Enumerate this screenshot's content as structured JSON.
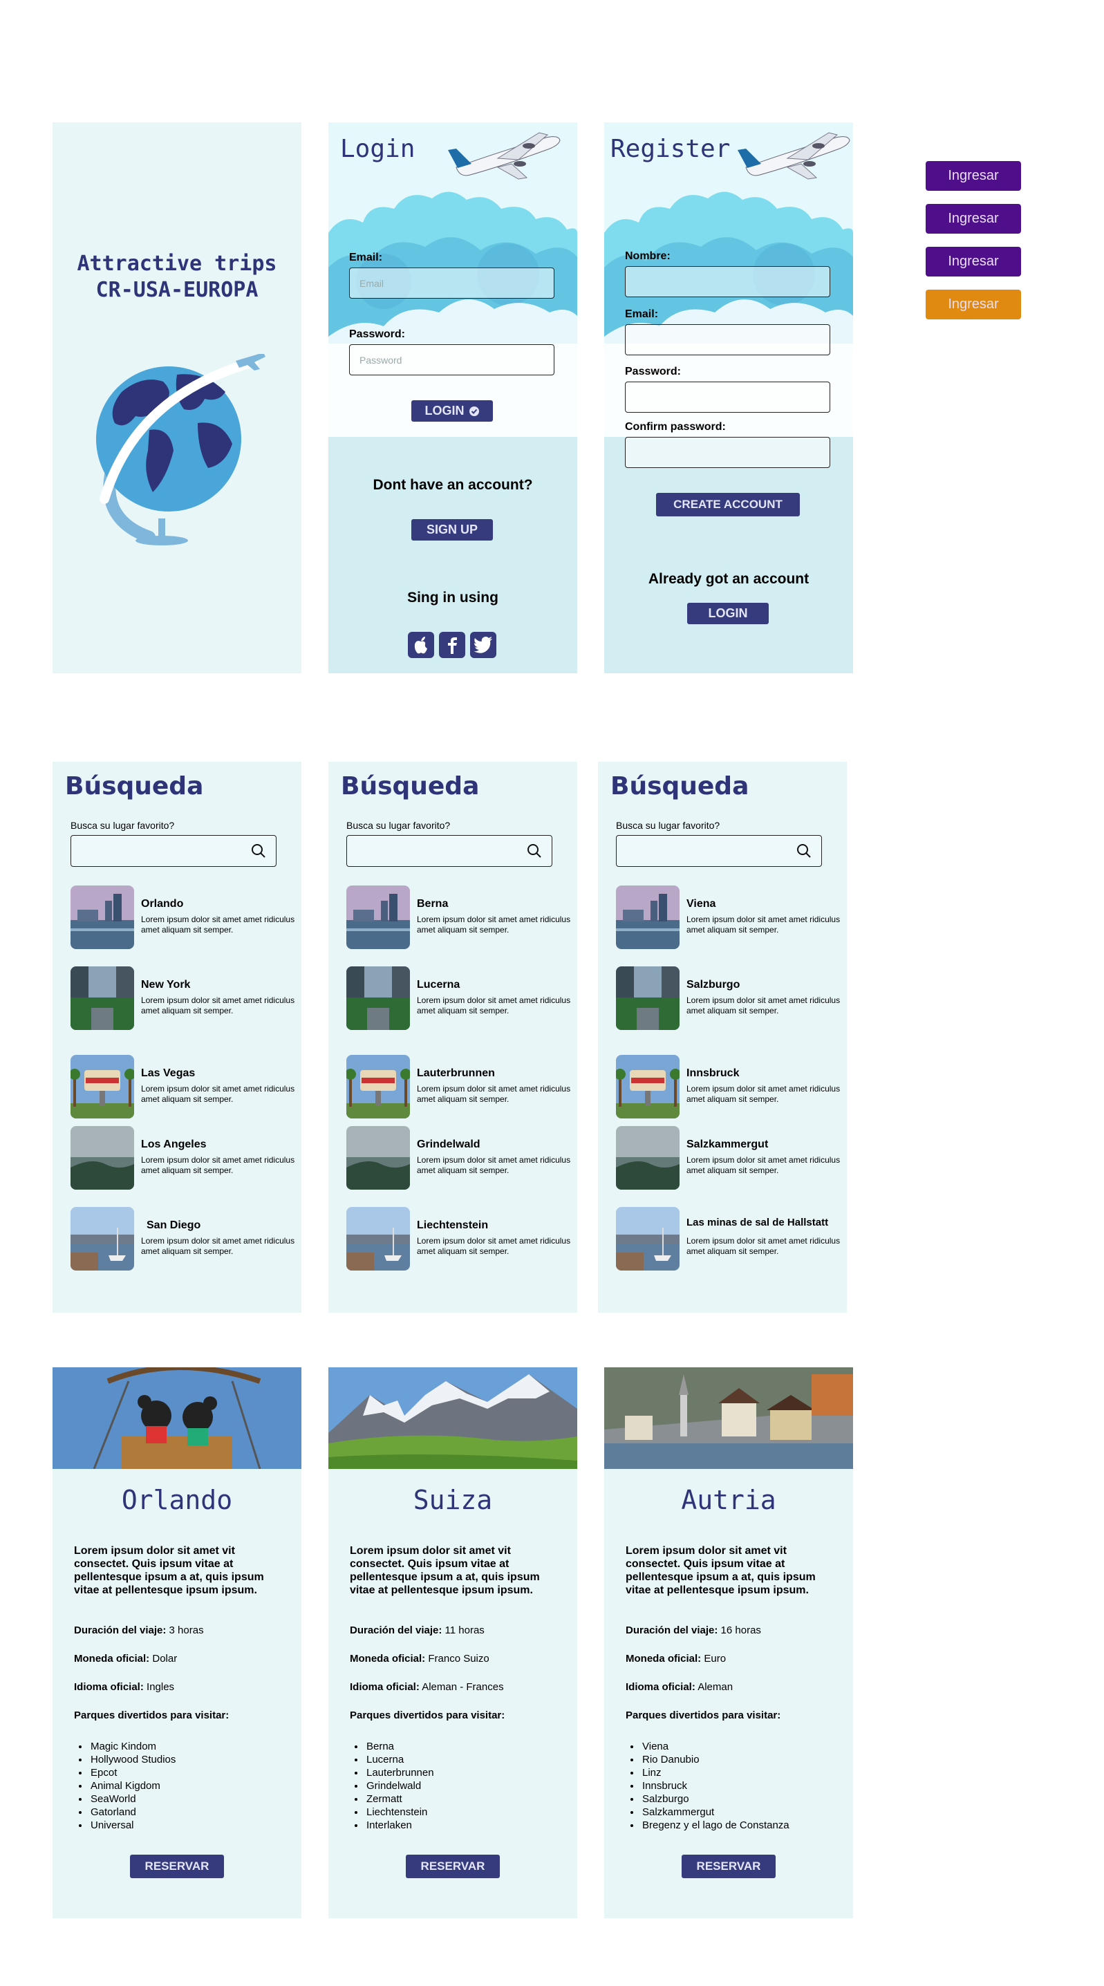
{
  "splash": {
    "title_line1": "Attractive trips",
    "title_line2": "CR-USA-EUROPA"
  },
  "login": {
    "title": "Login",
    "email_label": "Email:",
    "email_placeholder": "Email",
    "password_label": "Password:",
    "password_placeholder": "Password",
    "login_button": "LOGIN",
    "no_account_text": "Dont have an account?",
    "signup_button": "SIGN UP",
    "sign_in_using": "Sing in using"
  },
  "register": {
    "title": "Register",
    "nombre_label": "Nombre:",
    "email_label": "Email:",
    "password_label": "Password:",
    "confirm_label": "Confirm password:",
    "create_button": "CREATE ACCOUNT",
    "already_text": "Already got an account",
    "login_button": "LOGIN"
  },
  "side_buttons": [
    {
      "label": "Ingresar",
      "color": "#4f0f8a"
    },
    {
      "label": "Ingresar",
      "color": "#4f0f8a"
    },
    {
      "label": "Ingresar",
      "color": "#4f0f8a"
    },
    {
      "label": "Ingresar",
      "color": "#e08a12"
    }
  ],
  "search_common": {
    "title": "Búsqueda",
    "label": "Busca su lugar favorito?"
  },
  "search_usa": {
    "items": [
      {
        "name": "Orlando",
        "desc": "Lorem ipsum dolor sit amet amet ridiculus amet aliquam sit semper."
      },
      {
        "name": "New York",
        "desc": "Lorem ipsum dolor sit amet amet ridiculus amet aliquam sit semper."
      },
      {
        "name": "Las Vegas",
        "desc": "Lorem ipsum dolor sit amet amet ridiculus amet aliquam sit semper."
      },
      {
        "name": "Los Angeles",
        "desc": "Lorem ipsum dolor sit amet amet ridiculus amet aliquam sit semper."
      },
      {
        "name": "San Diego",
        "desc": "Lorem ipsum dolor sit amet amet ridiculus amet aliquam sit semper."
      }
    ]
  },
  "search_suiza": {
    "items": [
      {
        "name": "Berna",
        "desc": "Lorem ipsum dolor sit amet amet ridiculus amet aliquam sit semper."
      },
      {
        "name": "Lucerna",
        "desc": "Lorem ipsum dolor sit amet amet ridiculus amet aliquam sit semper."
      },
      {
        "name": "Lauterbrunnen",
        "desc": "Lorem ipsum dolor sit amet amet ridiculus amet aliquam sit semper."
      },
      {
        "name": "Grindelwald",
        "desc": "Lorem ipsum dolor sit amet amet ridiculus amet aliquam sit semper."
      },
      {
        "name": "Liechtenstein",
        "desc": "Lorem ipsum dolor sit amet amet ridiculus amet aliquam sit semper."
      }
    ]
  },
  "search_austria": {
    "items": [
      {
        "name": "Viena",
        "desc": "Lorem ipsum dolor sit amet amet ridiculus amet aliquam sit semper."
      },
      {
        "name": "Salzburgo",
        "desc": "Lorem ipsum dolor sit amet amet ridiculus amet aliquam sit semper."
      },
      {
        "name": "Innsbruck",
        "desc": "Lorem ipsum dolor sit amet amet ridiculus amet aliquam sit semper."
      },
      {
        "name": "Salzkammergut",
        "desc": "Lorem ipsum dolor sit amet amet ridiculus amet aliquam sit semper."
      },
      {
        "name": "Las minas de sal de Hallstatt",
        "desc": "Lorem ipsum dolor sit amet amet ridiculus amet aliquam sit semper."
      }
    ]
  },
  "detail_common": {
    "intro": "Lorem ipsum dolor sit amet vit consectet. Quis ipsum vitae at pellentesque ipsum a at, quis ipsum vitae at pellentesque ipsum ipsum.",
    "duracion_label": "Duración del viaje:",
    "moneda_label": "Moneda oficial:",
    "idioma_label": "Idioma oficial:",
    "parques_label": "Parques divertidos para visitar:",
    "reservar_button": "RESERVAR"
  },
  "detail_orlando": {
    "title": "Orlando",
    "duracion": "3 horas",
    "moneda": "Dolar",
    "idioma": "Ingles",
    "parques": [
      "Magic Kindom",
      "Hollywood Studios",
      "Epcot",
      "Animal Kigdom",
      "SeaWorld",
      "Gatorland",
      "Universal"
    ]
  },
  "detail_suiza": {
    "title": "Suiza",
    "duracion": "11 horas",
    "moneda": "Franco Suizo",
    "idioma": "Aleman - Frances",
    "parques": [
      "Berna",
      "Lucerna",
      "Lauterbrunnen",
      "Grindelwald",
      "Zermatt",
      "Liechtenstein",
      "Interlaken"
    ]
  },
  "detail_austria": {
    "title": "Autria",
    "duracion": "16 horas",
    "moneda": "Euro",
    "idioma": "Aleman",
    "parques": [
      "Viena",
      "Rio Danubio",
      "Linz",
      "Innsbruck",
      "Salzburgo",
      "Salzkammergut",
      "Bregenz y el lago de Constanza"
    ]
  },
  "colors": {
    "navy": "#353b7c",
    "title": "#2f3378",
    "pale_bg": "#e8f6f8",
    "auth_bg": "#d3eef2",
    "purple": "#4f0f8a",
    "orange": "#e08a12"
  }
}
